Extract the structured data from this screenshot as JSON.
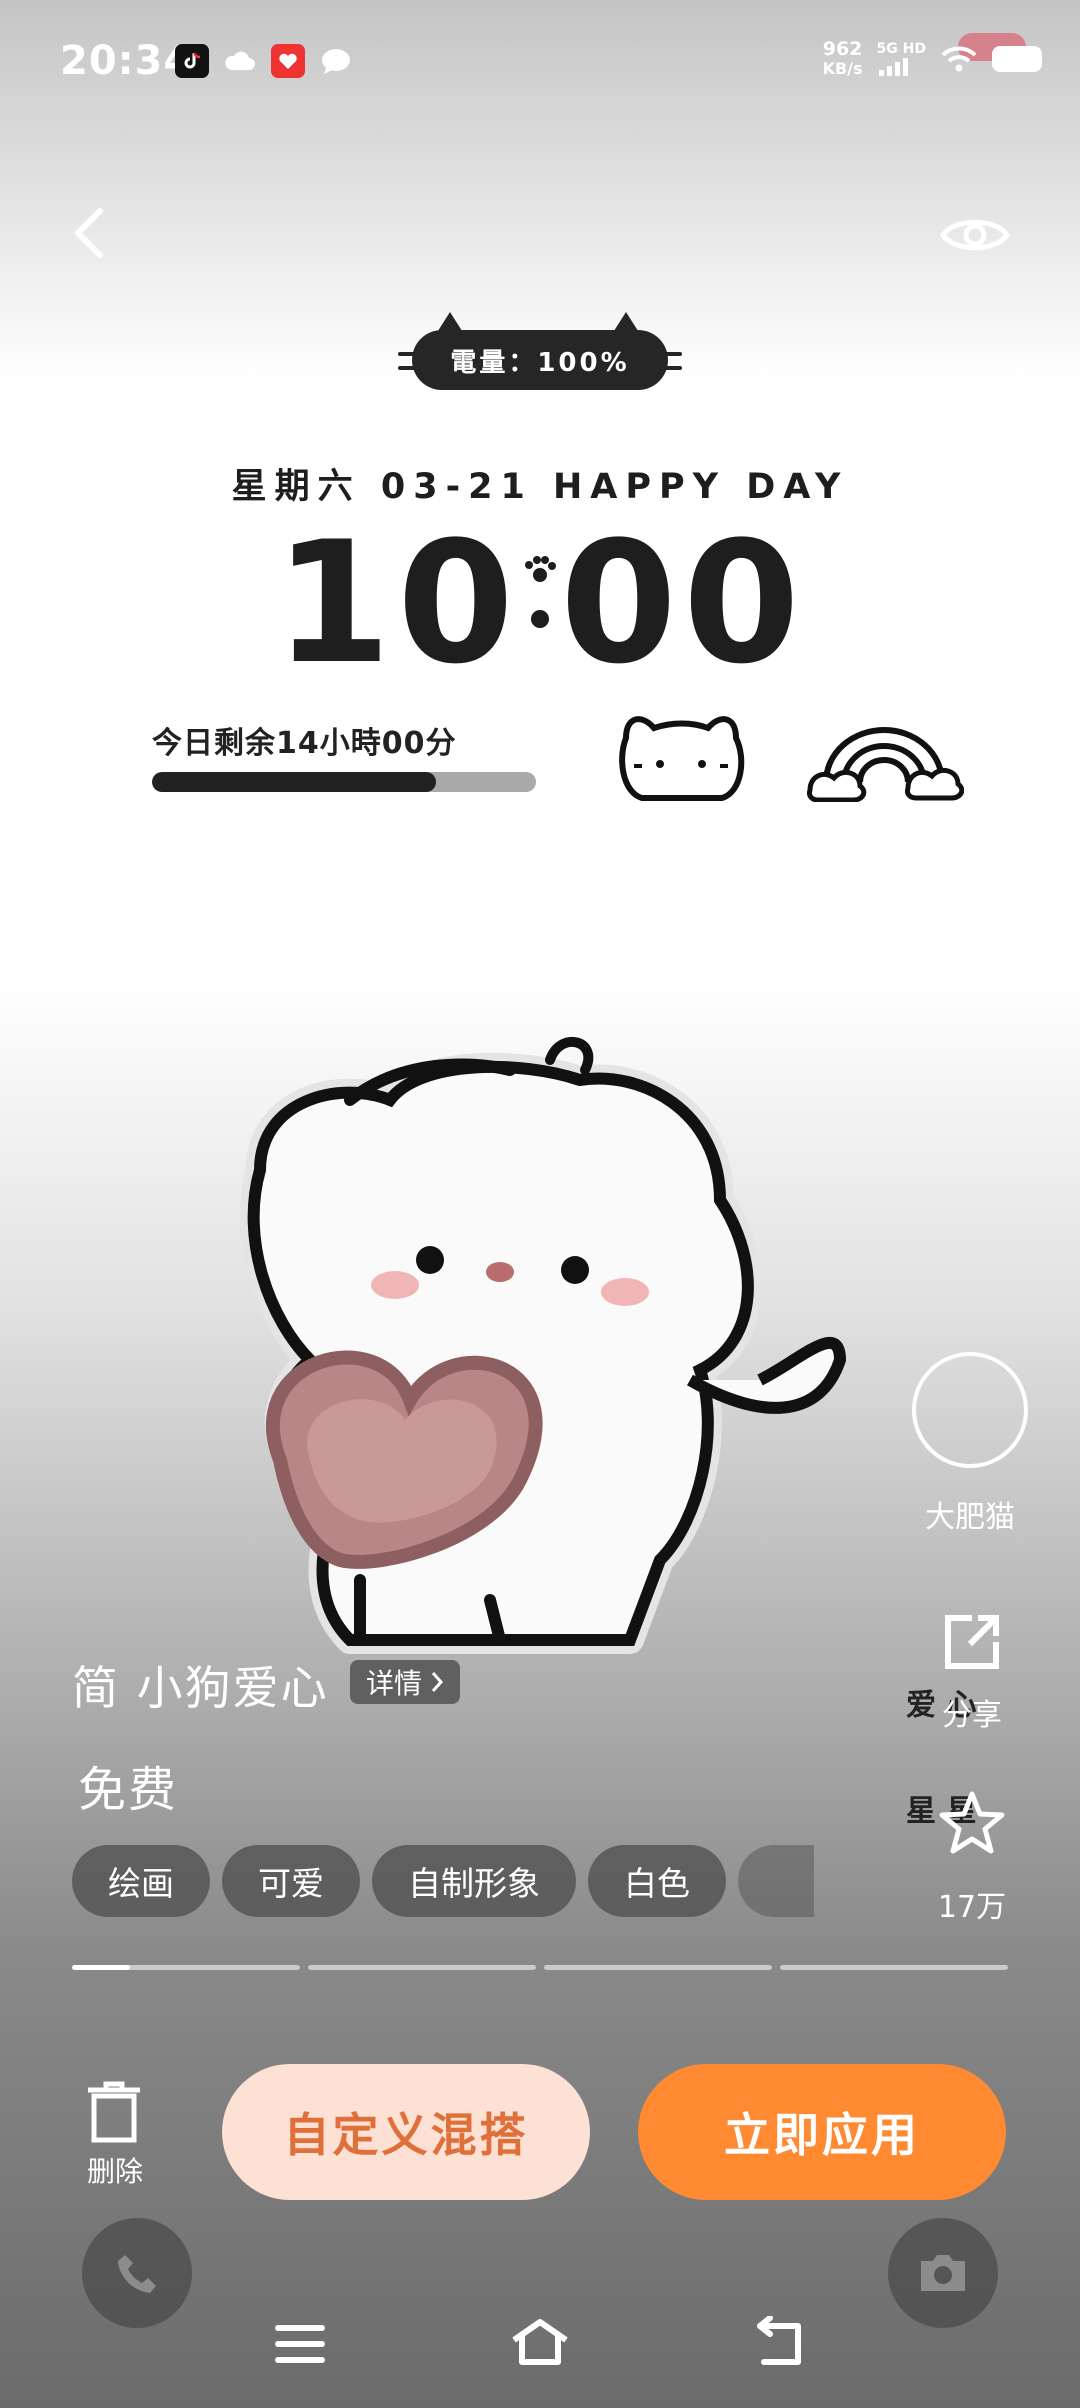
{
  "status_bar": {
    "time": "20:34",
    "net_speed_value": "962",
    "net_speed_unit": "KB/s",
    "signal_label": "5G HD",
    "notification_icons": [
      "tiktok-icon",
      "cloud-icon",
      "red-app-icon",
      "chat-bubble-icon"
    ]
  },
  "top_bar": {
    "back_icon": "chevron-left-icon",
    "preview_icon": "eye-icon"
  },
  "widget": {
    "battery_text": "電量：100%",
    "date_text": "星期六 03-21  HAPPY DAY",
    "clock_hour": "10",
    "clock_minute": "00",
    "remaining_text": "今日剩余14小時00分",
    "remaining_progress_fraction": 0.74
  },
  "side_rail": {
    "author_name": "大肥猫",
    "share_label": "分享",
    "favorite_count": "17万",
    "overlay_text_1": "爱 心",
    "overlay_text_2": "星 星"
  },
  "theme": {
    "title": "简 小狗爱心",
    "details_label": "详情",
    "price": "免费",
    "tags": [
      "绘画",
      "可爱",
      "自制形象",
      "白色"
    ],
    "page_index": 1,
    "page_count": 4
  },
  "actions": {
    "delete_label": "删除",
    "custom_mix_label": "自定义混搭",
    "apply_label": "立即应用"
  },
  "colors": {
    "accent_orange": "#ff8a32",
    "soft_orange": "#fde1d5",
    "custom_text": "#e0703a",
    "heart": "#b88686"
  }
}
